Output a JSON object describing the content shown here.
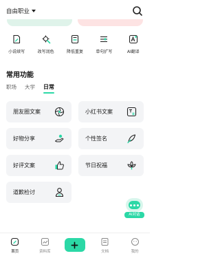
{
  "header": {
    "career_selector": "自由职业"
  },
  "quick_tools": [
    {
      "label": "小说续写",
      "icon": "document-pen-icon"
    },
    {
      "label": "改写润色",
      "icon": "magic-wand-icon"
    },
    {
      "label": "降低重复",
      "icon": "document-minus-icon"
    },
    {
      "label": "单句扩写",
      "icon": "expand-sliders-icon"
    },
    {
      "label": "AI翻译",
      "icon": "translate-icon"
    }
  ],
  "section": {
    "title": "常用功能"
  },
  "tabs": [
    {
      "label": "职场",
      "active": false
    },
    {
      "label": "大学",
      "active": false
    },
    {
      "label": "日常",
      "active": true
    }
  ],
  "features": [
    {
      "label": "朋友圈文案",
      "icon": "aperture-icon"
    },
    {
      "label": "小红书文案",
      "icon": "text-box-icon"
    },
    {
      "label": "好物分享",
      "icon": "hand-gift-icon"
    },
    {
      "label": "个性签名",
      "icon": "feather-pen-icon"
    },
    {
      "label": "好评文案",
      "icon": "thumbs-up-icon"
    },
    {
      "label": "节日祝福",
      "icon": "flower-icon"
    },
    {
      "label": "道歉检讨",
      "icon": "person-sorry-icon"
    }
  ],
  "fab": {
    "label": "AI对话"
  },
  "bottom_nav": [
    {
      "label": "首页",
      "active": true
    },
    {
      "label": "资料库",
      "active": false
    },
    {
      "label": "",
      "active": false
    },
    {
      "label": "文档",
      "active": false
    },
    {
      "label": "我的",
      "active": false
    }
  ],
  "colors": {
    "accent": "#2bd8a6",
    "card_bg": "#f3f4f6"
  }
}
